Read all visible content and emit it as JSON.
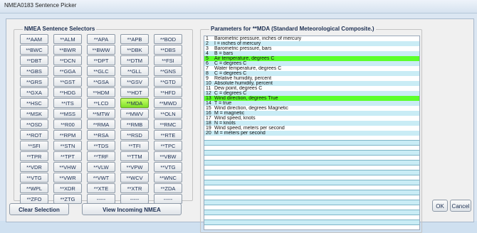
{
  "window": {
    "title": "NMEA0183 Sentence Picker"
  },
  "selectors": {
    "title": "NMEA Sentence Selectors",
    "active": "**MDA",
    "buttons": [
      [
        "**AAM",
        "**ALM",
        "**APA",
        "**APB",
        "**BOD"
      ],
      [
        "**BWC",
        "**BWR",
        "**BWW",
        "**DBK",
        "**DBS"
      ],
      [
        "**DBT",
        "**DCN",
        "**DPT",
        "**DTM",
        "**FSI"
      ],
      [
        "**GBS",
        "**GGA",
        "**GLC",
        "**GLL",
        "**GNS"
      ],
      [
        "**GRS",
        "**GST",
        "**GSA",
        "**GSV",
        "**GTD"
      ],
      [
        "**GXA",
        "**HDG",
        "**HDM",
        "**HDT",
        "**HFD"
      ],
      [
        "**HSC",
        "**ITS",
        "**LCD",
        "**MDA",
        "**MWD"
      ],
      [
        "**MSK",
        "**MSS",
        "**MTW",
        "**MWV",
        "**OLN"
      ],
      [
        "**OSD",
        "**R00",
        "**RMA",
        "**RMB",
        "**RMC"
      ],
      [
        "**ROT",
        "**RPM",
        "**RSA",
        "**RSD",
        "**RTE"
      ],
      [
        "**SFI",
        "**STN",
        "**TDS",
        "**TFI",
        "**TPC"
      ],
      [
        "**TPR",
        "**TPT",
        "**TRF",
        "**TTM",
        "**VBW"
      ],
      [
        "**VDR",
        "**VHW",
        "**VLW",
        "**VPW",
        "**VTG"
      ],
      [
        "**VTG",
        "**VWR",
        "**VWT",
        "**WCV",
        "**WNC"
      ],
      [
        "**WPL",
        "**XDR",
        "**XTE",
        "**XTR",
        "**ZDA"
      ],
      [
        "**ZFO",
        "**ZTG",
        "-----",
        "-----",
        "-----"
      ]
    ]
  },
  "parameters": {
    "title": "Parameters for **MDA  (Standard Meteorological Composite.)",
    "rows": [
      {
        "num": "1",
        "text": "Barometric pressure, inches of mercury",
        "style": "plain"
      },
      {
        "num": "2",
        "text": "I = inches of mercury",
        "style": "alt"
      },
      {
        "num": "3",
        "text": "Barometric pressure, bars",
        "style": "plain"
      },
      {
        "num": "4",
        "text": "B = bars",
        "style": "alt"
      },
      {
        "num": "5",
        "text": "Air temperature, degrees C",
        "style": "hl"
      },
      {
        "num": "6",
        "text": "C = degrees C",
        "style": "alt"
      },
      {
        "num": "7",
        "text": "Water temperature, degrees C",
        "style": "plain"
      },
      {
        "num": "8",
        "text": "C = degrees C",
        "style": "alt"
      },
      {
        "num": "9",
        "text": "Relative humidity, percent",
        "style": "plain"
      },
      {
        "num": "10",
        "text": "Absolute humidity, percent",
        "style": "alt"
      },
      {
        "num": "11",
        "text": "Dew point, degrees C",
        "style": "plain"
      },
      {
        "num": "12",
        "text": "C = degrees C",
        "style": "alt"
      },
      {
        "num": "13",
        "text": "Wind direction, degrees True",
        "style": "hl"
      },
      {
        "num": "14",
        "text": "T = true",
        "style": "alt"
      },
      {
        "num": "15",
        "text": "Wind direction, degrees Magnetic",
        "style": "plain"
      },
      {
        "num": "16",
        "text": "M = magnetic",
        "style": "alt"
      },
      {
        "num": "17",
        "text": "Wind speed, knots",
        "style": "plain"
      },
      {
        "num": "18",
        "text": "N = knots",
        "style": "alt"
      },
      {
        "num": "19",
        "text": "Wind speed, meters per second",
        "style": "plain"
      },
      {
        "num": "20",
        "text": "M = meters per second",
        "style": "alt"
      }
    ]
  },
  "actions": {
    "clear": "Clear Selection",
    "view": "View Incoming NMEA",
    "ok": "OK",
    "cancel": "Cancel"
  },
  "colors": {
    "highlight": "#5bff2a",
    "alt_row": "#c9ecf5",
    "active_button": "#7fe028"
  }
}
